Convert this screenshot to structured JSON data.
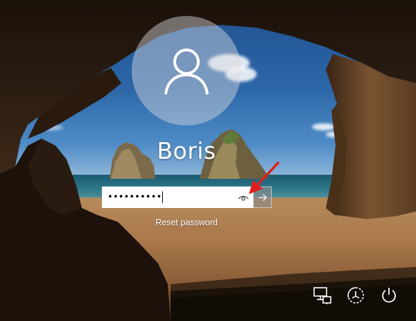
{
  "user": {
    "name": "Boris"
  },
  "password": {
    "masked_value": "••••••••••",
    "reveal_icon": "eye-icon",
    "submit_icon": "arrow-right-icon"
  },
  "links": {
    "reset_password": "Reset password"
  },
  "system_icons": [
    {
      "name": "network-icon"
    },
    {
      "name": "ease-of-access-icon"
    },
    {
      "name": "power-icon"
    }
  ],
  "colors": {
    "text": "#ffffff",
    "annotation_arrow": "#e0201b"
  }
}
